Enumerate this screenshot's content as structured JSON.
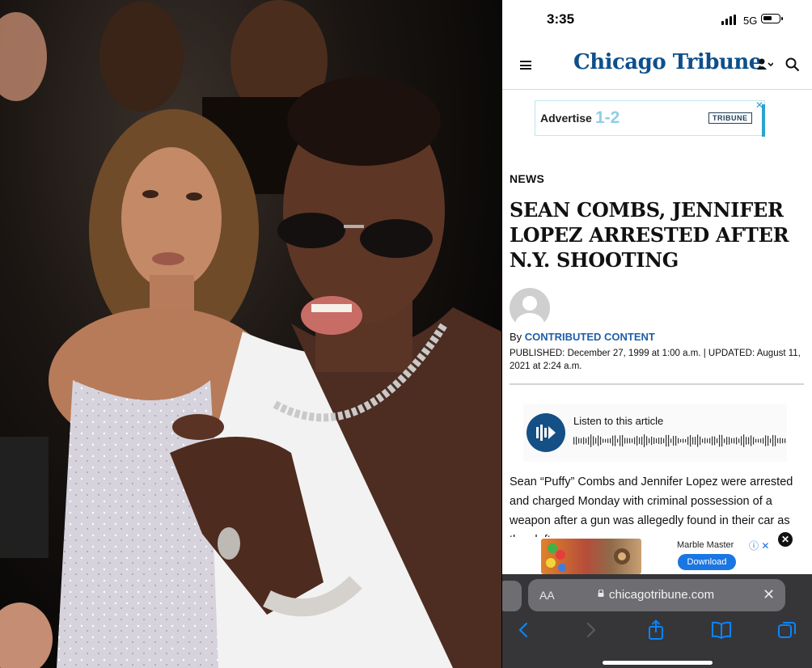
{
  "photo": {
    "description_icon": "photo-of-two-people"
  },
  "status_bar": {
    "time": "3:35",
    "network": "5G"
  },
  "header": {
    "logo": "Chicago Tribune"
  },
  "ad_top": {
    "text": "Advertise",
    "number": "1-2",
    "brand": "TRIBUNE",
    "close": "✕"
  },
  "article": {
    "section": "NEWS",
    "headline": "SEAN COMBS, JENNIFER LOPEZ ARRESTED AFTER N.Y. SHOOTING",
    "byline_prefix": "By",
    "author": "CONTRIBUTED CONTENT",
    "published": "PUBLISHED: December 27, 1999 at 1:00 a.m. | UPDATED: August 11, 2021 at 2:24 a.m.",
    "listen_label": "Listen to this article",
    "body": "Sean “Puffy” Combs and Jennifer Lopez were arrested and charged Monday with criminal possession of a weapon after a gun was allegedly found in their car as they left a"
  },
  "ad_bottom": {
    "title": "Marble Master",
    "button": "Download",
    "close": "✕"
  },
  "browser": {
    "aa": "AA",
    "domain": "chicagotribune.com",
    "clear": "✕"
  },
  "colors": {
    "brand_blue": "#0d4f8b",
    "link_blue": "#1f5fa8",
    "browser_bg": "#363638",
    "ios_blue": "#0a84ff"
  }
}
